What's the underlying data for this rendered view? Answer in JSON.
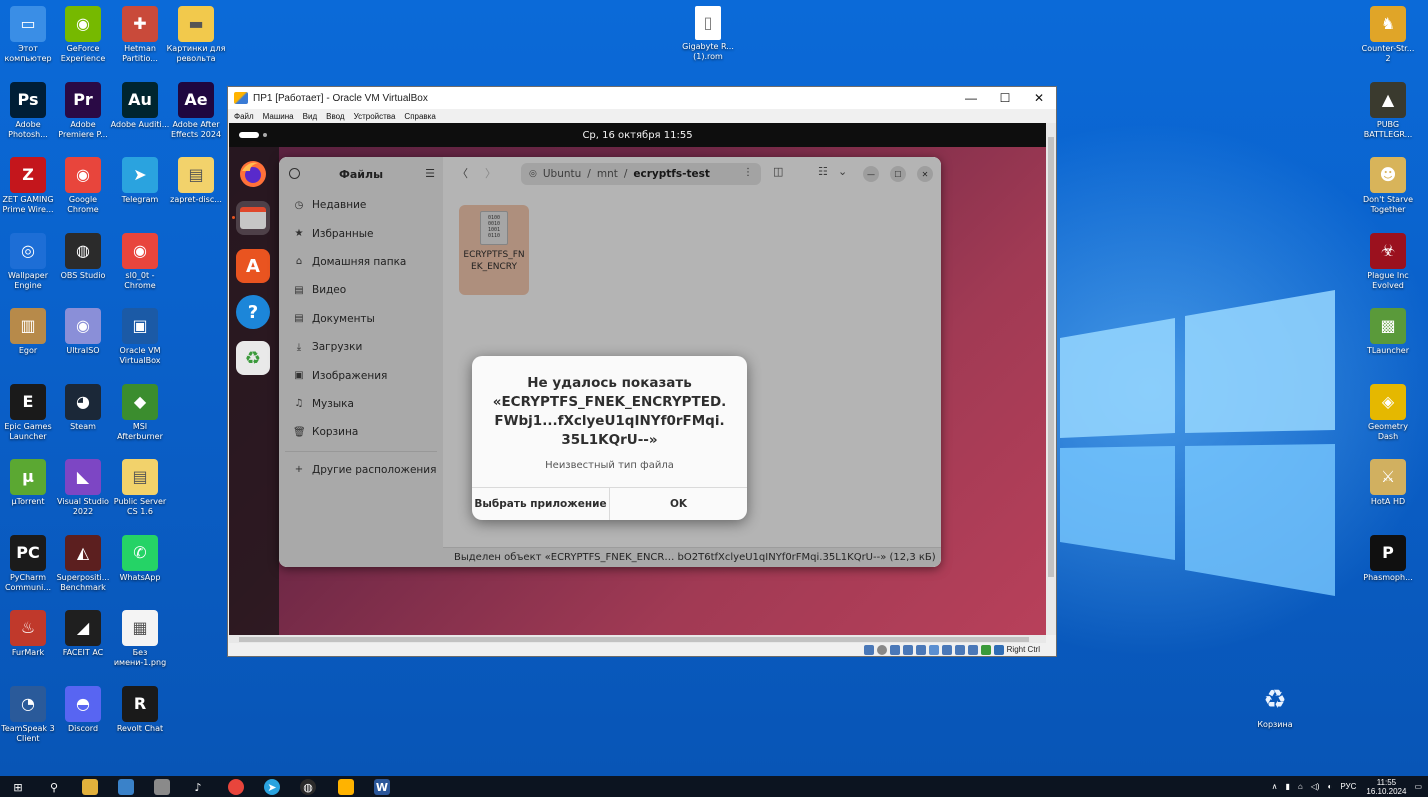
{
  "desktop": {
    "icons": [
      {
        "label": "Этот компьютер",
        "color": "#3a8ee6",
        "glyph": "▭"
      },
      {
        "label": "GeForce Experience",
        "color": "#76b900",
        "glyph": "◉"
      },
      {
        "label": "Hetman Partitio...",
        "color": "#c94a3a",
        "glyph": "✚"
      },
      {
        "label": "Картинки для револьта",
        "color": "#f2c94c",
        "glyph": "▬"
      },
      {
        "label": "Adobe Photosh...",
        "color": "#001e36",
        "glyph": "Ps"
      },
      {
        "label": "Adobe Premiere P...",
        "color": "#2a0a45",
        "glyph": "Pr"
      },
      {
        "label": "Adobe Auditi...",
        "color": "#00252f",
        "glyph": "Au"
      },
      {
        "label": "Adobe After Effects 2024",
        "color": "#1f0740",
        "glyph": "Ae"
      },
      {
        "label": "ZET GAMING Prime Wire...",
        "color": "#c4161c",
        "glyph": "Z"
      },
      {
        "label": "Google Chrome",
        "color": "#e8453c",
        "glyph": "◉"
      },
      {
        "label": "Telegram",
        "color": "#2aa3df",
        "glyph": "➤"
      },
      {
        "label": "zapret-disc...",
        "color": "#f2d26b",
        "glyph": "▤"
      },
      {
        "label": "Wallpaper Engine",
        "color": "#1d6ed6",
        "glyph": "◎"
      },
      {
        "label": "OBS Studio",
        "color": "#2b2b2b",
        "glyph": "◍"
      },
      {
        "label": "sl0_0t - Chrome",
        "color": "#e8453c",
        "glyph": "◉"
      },
      {
        "label": "Egor",
        "color": "#b78a4a",
        "glyph": "▥"
      },
      {
        "label": "UltraISO",
        "color": "#8a8fd8",
        "glyph": "◉"
      },
      {
        "label": "Oracle VM VirtualBox",
        "color": "#1b5aa6",
        "glyph": "▣"
      },
      {
        "label": "Epic Games Launcher",
        "color": "#1a1a1a",
        "glyph": "E"
      },
      {
        "label": "Steam",
        "color": "#1b2838",
        "glyph": "◕"
      },
      {
        "label": "MSI Afterburner",
        "color": "#3b8d2e",
        "glyph": "◆"
      },
      {
        "label": "µTorrent",
        "color": "#5ba832",
        "glyph": "µ"
      },
      {
        "label": "Visual Studio 2022",
        "color": "#7d46c4",
        "glyph": "◣"
      },
      {
        "label": "Public Server CS 1.6",
        "color": "#f2d26b",
        "glyph": "▤"
      },
      {
        "label": "PyCharm Communi...",
        "color": "#1b1b1b",
        "glyph": "PC"
      },
      {
        "label": "Superpositi... Benchmark",
        "color": "#5c1f1f",
        "glyph": "◭"
      },
      {
        "label": "WhatsApp",
        "color": "#25d366",
        "glyph": "✆"
      },
      {
        "label": "FurMark",
        "color": "#c0392b",
        "glyph": "♨"
      },
      {
        "label": "FACEIT AC",
        "color": "#1f1f1f",
        "glyph": "◢"
      },
      {
        "label": "Без имени-1.png",
        "color": "#f4f4f4",
        "glyph": "▦"
      },
      {
        "label": "TeamSpeak 3 Client",
        "color": "#2a5a9a",
        "glyph": "◔"
      },
      {
        "label": "Discord",
        "color": "#5865f2",
        "glyph": "◓"
      },
      {
        "label": "Revolt Chat",
        "color": "#1a1a1a",
        "glyph": "R"
      }
    ],
    "right_icons": [
      {
        "label": "Counter-Str... 2",
        "color": "#e0a528",
        "glyph": "♞"
      },
      {
        "label": "PUBG BATTLEGR...",
        "color": "#3a3a2e",
        "glyph": "▲"
      },
      {
        "label": "Don't Starve Together",
        "color": "#d8b45a",
        "glyph": "☻"
      },
      {
        "label": "Plague Inc Evolved",
        "color": "#9b111e",
        "glyph": "☣"
      },
      {
        "label": "TLauncher",
        "color": "#5a9a3a",
        "glyph": "▩"
      },
      {
        "label": "Geometry Dash",
        "color": "#e5b800",
        "glyph": "◈"
      },
      {
        "label": "HotA HD",
        "color": "#d1b060",
        "glyph": "⚔"
      },
      {
        "label": "Phasmoph...",
        "color": "#101010",
        "glyph": "P"
      }
    ],
    "file_icon": {
      "label": "Gigabyte R... (1).rom",
      "glyph": "▯"
    },
    "recycle_bin": {
      "label": "Корзина",
      "glyph": "♻"
    }
  },
  "vbox": {
    "title": "ПР1 [Работает] - Oracle VM VirtualBox",
    "controls": [
      "—",
      "☐",
      "✕"
    ],
    "menu": [
      "Файл",
      "Машина",
      "Вид",
      "Ввод",
      "Устройства",
      "Справка"
    ],
    "status_host_key": "Right Ctrl"
  },
  "ubuntu": {
    "clock": "Ср, 16 октября  11:55",
    "dock": [
      {
        "name": "firefox",
        "color": "#e66000",
        "glyph": "◕"
      },
      {
        "name": "files",
        "color": "#d8d8d8",
        "glyph": "▬"
      },
      {
        "name": "app-center",
        "color": "#e95420",
        "glyph": "A"
      },
      {
        "name": "help",
        "color": "#1c86d9",
        "glyph": "?"
      },
      {
        "name": "trash",
        "color": "#e9e9e9",
        "glyph": "♻"
      }
    ]
  },
  "files": {
    "sidebar_title": "Файлы",
    "sidebar_items": [
      {
        "label": "Недавние",
        "icon": "◷"
      },
      {
        "label": "Избранные",
        "icon": "★"
      },
      {
        "label": "Домашняя папка",
        "icon": "⌂"
      },
      {
        "label": "Видео",
        "icon": "▤"
      },
      {
        "label": "Документы",
        "icon": "▤"
      },
      {
        "label": "Загрузки",
        "icon": "⤓"
      },
      {
        "label": "Изображения",
        "icon": "▣"
      },
      {
        "label": "Музыка",
        "icon": "♫"
      },
      {
        "label": "Корзина",
        "icon": "🗑"
      }
    ],
    "other_locations": {
      "label": "Другие расположения",
      "icon": "+"
    },
    "path": [
      "Ubuntu",
      "/",
      "mnt",
      "/",
      "ecryptfs-test"
    ],
    "file": {
      "name": "ECRYPTFS_FNEK_ENCRYPTED...",
      "short_name": "ECRYPTFS_FNEK_ENCRY",
      "bits": "0100 0010 1001 0110"
    },
    "status": "Выделен объект «ECRYPTFS_FNEK_ENCR… bO2T6tfXclyeU1qINYf0rFMqi.35L1KQrU--» (12,3 кБ)"
  },
  "dialog": {
    "title_line1": "Не удалось показать",
    "title_line2": "«ECRYPTFS_FNEK_ENCRYPTED.",
    "title_line3": "FWbj1...fXclyeU1qINYf0rFMqi.",
    "title_line4": "35L1KQrU--»",
    "subtitle": "Неизвестный тип файла",
    "choose_app": "Выбрать приложение",
    "ok": "OK"
  },
  "taskbar": {
    "lang": "РУС",
    "time": "11:55",
    "date": "16.10.2024"
  }
}
